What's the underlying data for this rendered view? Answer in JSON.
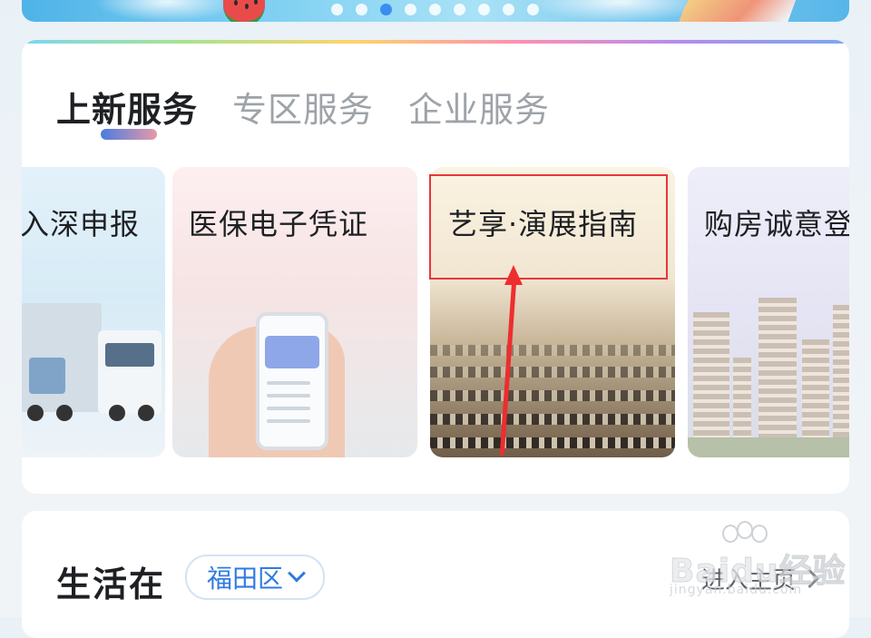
{
  "banner": {
    "carousel_dot_count": 9,
    "active_dot_index": 2
  },
  "services": {
    "tabs": [
      {
        "label": "上新服务",
        "active": true
      },
      {
        "label": "专区服务",
        "active": false
      },
      {
        "label": "企业服务",
        "active": false
      }
    ],
    "tiles": [
      {
        "title": "入深申报",
        "icon": "trucks-image"
      },
      {
        "title": "医保电子凭证",
        "icon": "phone-in-hand-image"
      },
      {
        "title": "艺享·演展指南",
        "icon": "orchestra-image"
      },
      {
        "title": "购房诚意登",
        "icon": "buildings-image"
      }
    ]
  },
  "annotation": {
    "highlight_color": "#e8363a",
    "arrow_color": "#ee2d2f"
  },
  "life": {
    "title": "生活在",
    "district": "福田区",
    "enter_label": "进入主页"
  },
  "watermark": {
    "brand": "Baidu经验",
    "url": "jingyan.baidu.com"
  },
  "colors": {
    "accent_blue": "#2f7be0",
    "text_primary": "#1e2024",
    "text_muted": "#9ea3a8"
  }
}
